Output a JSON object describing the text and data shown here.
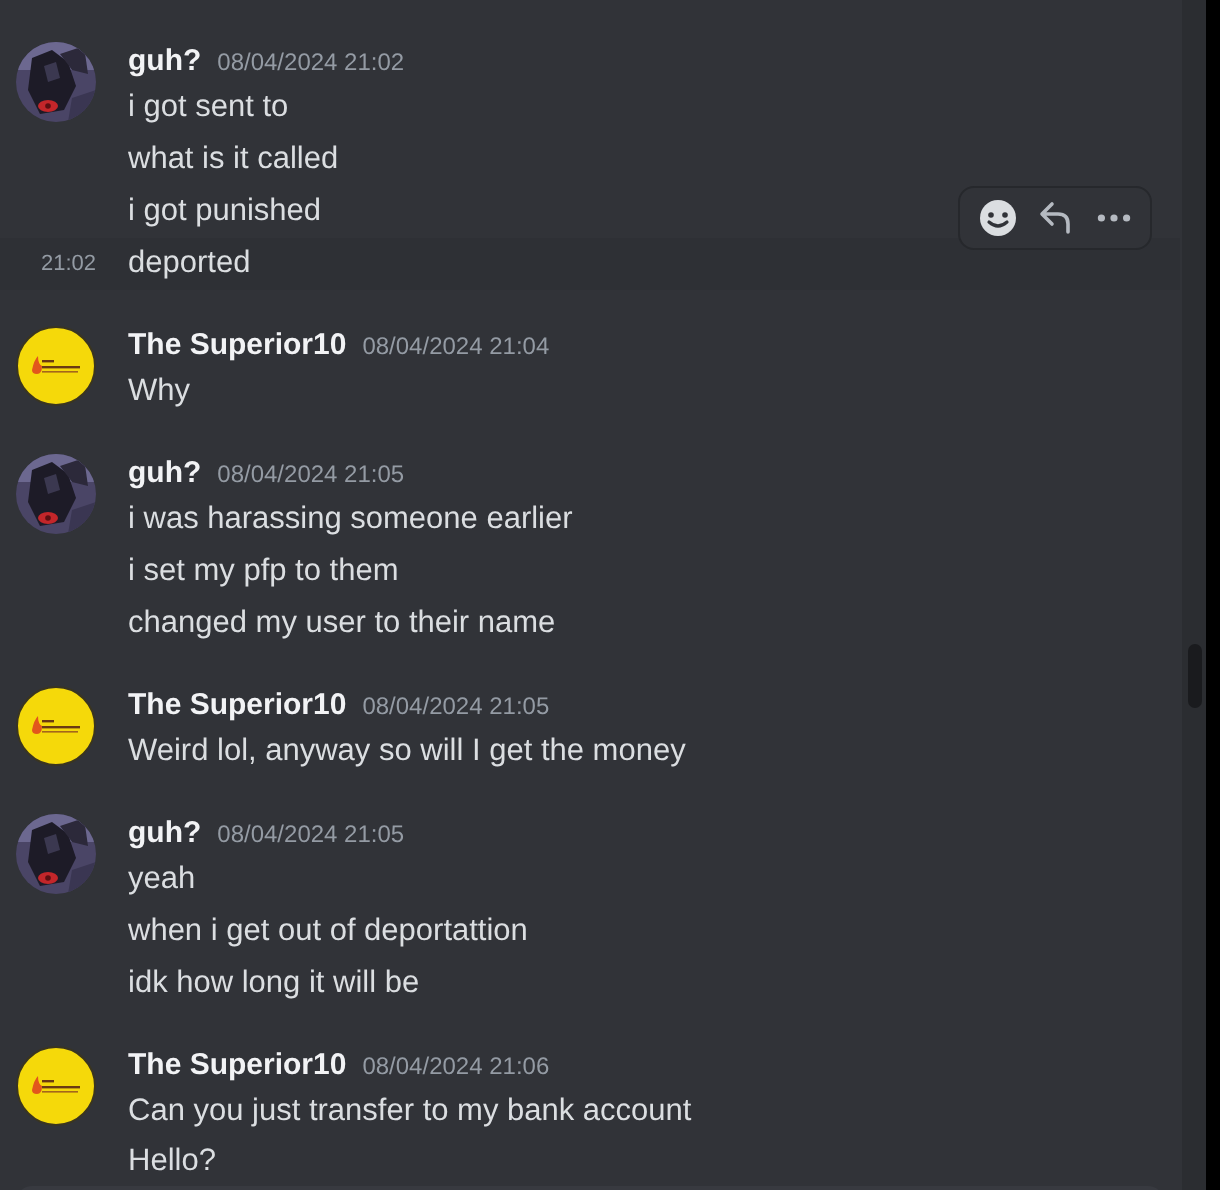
{
  "messages_list": [
    {
      "author": "guh?",
      "timestamp": "08/04/2024 21:02",
      "lines": [
        {
          "text": "i got sent to",
          "hovered": false
        },
        {
          "text": "what is it called",
          "hovered": false
        },
        {
          "text": "i got punished",
          "hovered": false
        },
        {
          "text": "deported",
          "hovered": true,
          "time": "21:02"
        }
      ]
    },
    {
      "author": "The Superior10",
      "kind": "logo",
      "timestamp": "08/04/2024 21:04",
      "lines": [
        {
          "text": "Why",
          "hovered": false
        }
      ]
    },
    {
      "author": "guh?",
      "timestamp": "08/04/2024 21:05",
      "lines": [
        {
          "text": "i was harassing someone earlier",
          "hovered": false
        },
        {
          "text": "i set my pfp to them",
          "hovered": false
        },
        {
          "text": "changed my user to their name",
          "hovered": false
        }
      ]
    },
    {
      "author": "The Superior10",
      "kind": "logo",
      "timestamp": "08/04/2024 21:05",
      "lines": [
        {
          "text": "Weird lol, anyway so will I get the money",
          "hovered": false
        }
      ]
    },
    {
      "author": "guh?",
      "timestamp": "08/04/2024 21:05",
      "lines": [
        {
          "text": "yeah",
          "hovered": false
        },
        {
          "text": "when i get out of deportattion",
          "hovered": false
        },
        {
          "text": "idk how long it will be",
          "hovered": false
        }
      ]
    },
    {
      "author": "The Superior10",
      "kind": "logo",
      "timestamp": "08/04/2024 21:06",
      "lines": [
        {
          "text": "Can you just transfer to my bank account",
          "hovered": false
        },
        {
          "text": "Hello?",
          "hovered": false
        }
      ]
    }
  ]
}
